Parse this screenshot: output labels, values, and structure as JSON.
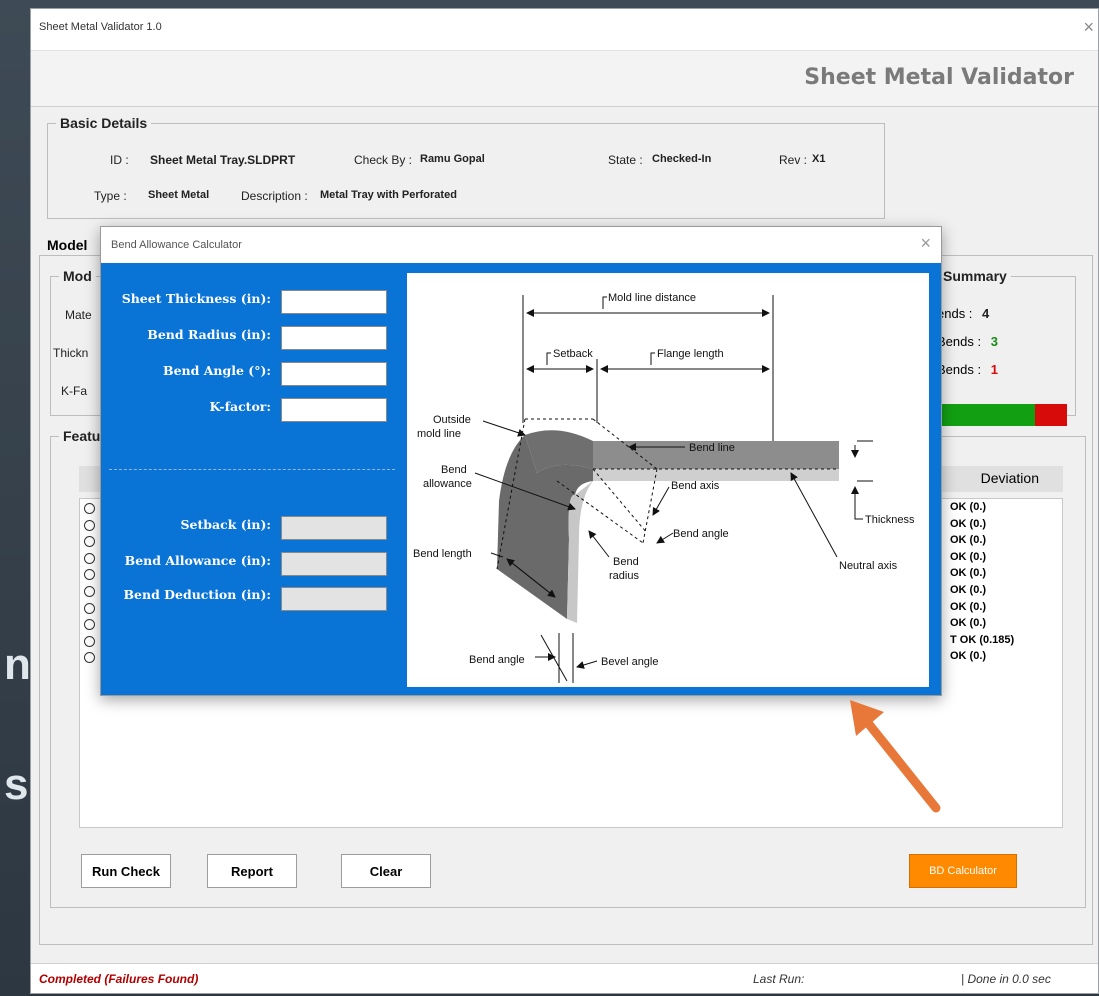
{
  "background": {
    "letters": [
      "n",
      "s"
    ]
  },
  "window": {
    "title": "Sheet Metal Validator 1.0",
    "close": "×"
  },
  "header": {
    "app_title": "Sheet Metal Validator"
  },
  "basic": {
    "legend": "Basic Details",
    "id_label": "ID  :",
    "id_value": "Sheet Metal Tray.SLDPRT",
    "check_label": "Check By :",
    "check_value": "Ramu Gopal",
    "state_label": "State :",
    "state_value": "Checked-In",
    "rev_label": "Rev :",
    "rev_value": "X1",
    "type_label": "Type  :",
    "type_value": "Sheet Metal",
    "desc_label": "Description :",
    "desc_value": "Metal Tray with Perforated"
  },
  "model": {
    "tab_label": "Model",
    "inner_legend": "Mod",
    "mat_label": "Mate",
    "thick_label": "Thickn",
    "kfactor_label": "K-Fa",
    "features_legend": "Featu"
  },
  "summary": {
    "legend": "Summary",
    "rows": [
      {
        "label": "ends :",
        "value": "4"
      },
      {
        "label": "Bends :",
        "value": "3"
      },
      {
        "label": "Bends :",
        "value": "1"
      }
    ],
    "ok_fraction": 0.75,
    "colors": {
      "total": "#222222",
      "ok": "#1a8a1a",
      "fail": "#d80b0b"
    }
  },
  "grid": {
    "deviation_header": "Deviation",
    "rows": [
      "OK (0.)",
      "OK (0.)",
      "OK (0.)",
      "OK (0.)",
      "OK (0.)",
      "OK (0.)",
      "OK (0.)",
      "OK (0.)",
      "T OK (0.185)",
      "OK (0.)"
    ]
  },
  "buttons": {
    "run": "Run Check",
    "report": "Report",
    "clear": "Clear",
    "bd": "BD Calculator"
  },
  "status": {
    "left": "Completed (Failures Found)",
    "middle": "Last Run:",
    "right": "| Done in 0.0 sec"
  },
  "dialog": {
    "title": "Bend Allowance Calculator",
    "close": "×",
    "inputs": {
      "thickness": "Sheet Thickness (in):",
      "radius": "Bend Radius (in):",
      "angle": "Bend Angle (°):",
      "kfactor": "K-factor:"
    },
    "outputs": {
      "setback": "Setback (in):",
      "allowance": "Bend Allowance (in):",
      "deduction": "Bend Deduction (in):"
    },
    "diagram": {
      "mold_line_distance": "Mold line distance",
      "setback": "Setback",
      "flange_length": "Flange length",
      "outside_mold_line_1": "Outside",
      "outside_mold_line_2": "mold line",
      "bend_line": "Bend line",
      "bend_allowance_1": "Bend",
      "bend_allowance_2": "allowance",
      "bend_axis": "Bend axis",
      "bend_angle": "Bend angle",
      "thickness": "Thickness",
      "bend_length": "Bend length",
      "bend_radius_1": "Bend",
      "bend_radius_2": "radius",
      "neutral_axis": "Neutral axis",
      "bend_angle_bottom": "Bend angle",
      "bevel_angle": "Bevel angle"
    }
  },
  "colors": {
    "accent_blue": "#0a73d6",
    "orange": "#ff8a00",
    "annotation_arrow": "#e8783a"
  }
}
